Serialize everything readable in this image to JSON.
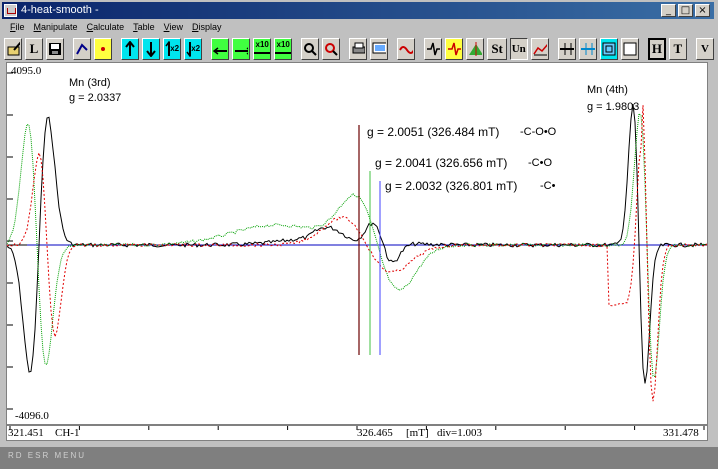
{
  "window": {
    "title": "4-heat-smooth -",
    "buttons": [
      "_",
      "□",
      "×"
    ]
  },
  "menu": [
    "File",
    "Manipulate",
    "Calculate",
    "Table",
    "View",
    "Display"
  ],
  "toolbar": {
    "label_L": "L",
    "label_St": "St",
    "label_Un": "Un",
    "label_H": "H",
    "label_T": "T",
    "label_V": "V",
    "label_x2a": "x2",
    "label_x2b": "x2",
    "label_x10a": "x10",
    "label_x10b": "x10"
  },
  "plot": {
    "y_max": "4095.0",
    "y_min": "-4096.0",
    "mn3_name": "Mn (3rd)",
    "mn3_g": "g = 2.0337",
    "mn4_name": "Mn (4th)",
    "mn4_g": "g = 1.9803",
    "peak1": "g = 2.0051 (326.484 mT)",
    "peak1_group": "-C-O•O",
    "peak2": "g = 2.0041 (326.656 mT)",
    "peak2_group": "-C•O",
    "peak3": "g = 2.0032 (326.801 mT)",
    "peak3_group": "-C•",
    "colors": {
      "black": "#000000",
      "red": "#e00000",
      "green": "#00a000",
      "blue": "#0000c0",
      "marker_dark": "#6b0000",
      "marker_green": "#40c040",
      "marker_blue": "#4040ff"
    }
  },
  "axis": {
    "x_start": "321.451",
    "channel": "CH-1",
    "x_center": "326.465",
    "unit": "[mT]",
    "div": "div=1.003",
    "x_end": "331.478"
  },
  "status_text": "RD ESR MENU"
}
